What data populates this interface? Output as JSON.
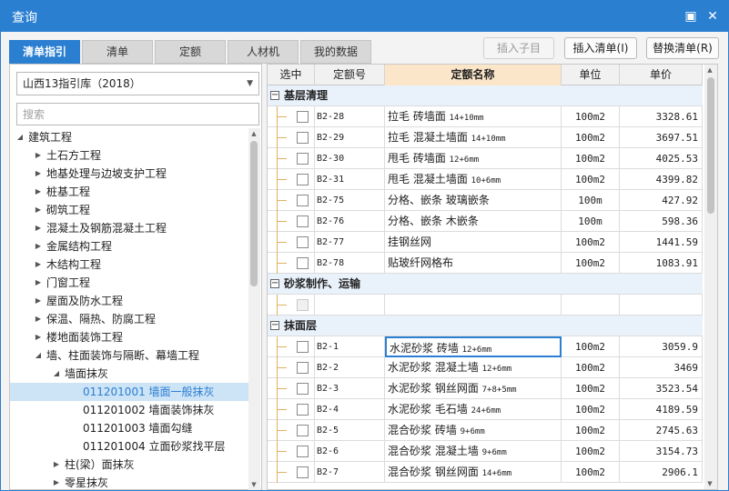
{
  "window": {
    "title": "查询",
    "restore_symbol": "▣",
    "close_symbol": "✕"
  },
  "tabs": [
    "清单指引",
    "清单",
    "定额",
    "人材机",
    "我的数据"
  ],
  "toolbar": {
    "insert_child": "插入子目",
    "insert_list": "插入清单(I)",
    "replace_list": "替换清单(R)"
  },
  "library": {
    "selected": "山西13指引库（2018）"
  },
  "search": {
    "placeholder": "搜索"
  },
  "tree": [
    {
      "label": "建筑工程",
      "level": 0,
      "state": "expanded"
    },
    {
      "label": "土石方工程",
      "level": 1,
      "state": "collapsed"
    },
    {
      "label": "地基处理与边坡支护工程",
      "level": 1,
      "state": "collapsed"
    },
    {
      "label": "桩基工程",
      "level": 1,
      "state": "collapsed"
    },
    {
      "label": "砌筑工程",
      "level": 1,
      "state": "collapsed"
    },
    {
      "label": "混凝土及钢筋混凝土工程",
      "level": 1,
      "state": "collapsed"
    },
    {
      "label": "金属结构工程",
      "level": 1,
      "state": "collapsed"
    },
    {
      "label": "木结构工程",
      "level": 1,
      "state": "collapsed"
    },
    {
      "label": "门窗工程",
      "level": 1,
      "state": "collapsed"
    },
    {
      "label": "屋面及防水工程",
      "level": 1,
      "state": "collapsed"
    },
    {
      "label": "保温、隔热、防腐工程",
      "level": 1,
      "state": "collapsed"
    },
    {
      "label": "楼地面装饰工程",
      "level": 1,
      "state": "collapsed"
    },
    {
      "label": "墙、柱面装饰与隔断、幕墙工程",
      "level": 1,
      "state": "expanded"
    },
    {
      "label": "墙面抹灰",
      "level": 2,
      "state": "expanded"
    },
    {
      "label": "011201001  墙面一般抹灰",
      "level": 3,
      "state": "leaf",
      "selected": true
    },
    {
      "label": "011201002  墙面装饰抹灰",
      "level": 3,
      "state": "leaf"
    },
    {
      "label": "011201003  墙面勾缝",
      "level": 3,
      "state": "leaf"
    },
    {
      "label": "011201004  立面砂浆找平层",
      "level": 3,
      "state": "leaf"
    },
    {
      "label": "柱(梁）面抹灰",
      "level": 2,
      "state": "collapsed"
    },
    {
      "label": "零星抹灰",
      "level": 2,
      "state": "collapsed"
    }
  ],
  "grid": {
    "headers": [
      "选中",
      "定额号",
      "定额名称",
      "单位",
      "单价"
    ],
    "groups": [
      {
        "name": "基层清理",
        "rows": [
          {
            "code": "B2-28",
            "name": "拉毛 砖墙面 ",
            "size": "14+10mm",
            "unit": "100m2",
            "price": "3328.61"
          },
          {
            "code": "B2-29",
            "name": "拉毛 混凝土墙面 ",
            "size": "14+10mm",
            "unit": "100m2",
            "price": "3697.51"
          },
          {
            "code": "B2-30",
            "name": "甩毛 砖墙面 ",
            "size": "12+6mm",
            "unit": "100m2",
            "price": "4025.53"
          },
          {
            "code": "B2-31",
            "name": "甩毛 混凝土墙面 ",
            "size": "10+6mm",
            "unit": "100m2",
            "price": "4399.82"
          },
          {
            "code": "B2-75",
            "name": "分格、嵌条 玻璃嵌条",
            "size": "",
            "unit": "100m",
            "price": "427.92"
          },
          {
            "code": "B2-76",
            "name": "分格、嵌条 木嵌条",
            "size": "",
            "unit": "100m",
            "price": "598.36"
          },
          {
            "code": "B2-77",
            "name": "挂钢丝网",
            "size": "",
            "unit": "100m2",
            "price": "1441.59"
          },
          {
            "code": "B2-78",
            "name": "贴玻纤网格布",
            "size": "",
            "unit": "100m2",
            "price": "1083.91"
          }
        ]
      },
      {
        "name": "砂浆制作、运输",
        "rows": [
          {
            "code": "",
            "name": "",
            "size": "",
            "unit": "",
            "price": "",
            "empty": true
          }
        ]
      },
      {
        "name": "抹面层",
        "rows": [
          {
            "code": "B2-1",
            "name": "水泥砂浆 砖墙 ",
            "size": "12+6mm",
            "unit": "100m2",
            "price": "3059.9",
            "focused": true
          },
          {
            "code": "B2-2",
            "name": "水泥砂浆 混凝土墙 ",
            "size": "12+6mm",
            "unit": "100m2",
            "price": "3469"
          },
          {
            "code": "B2-3",
            "name": "水泥砂浆 钢丝网面 ",
            "size": "7+8+5mm",
            "unit": "100m2",
            "price": "3523.54"
          },
          {
            "code": "B2-4",
            "name": "水泥砂浆 毛石墙 ",
            "size": "24+6mm",
            "unit": "100m2",
            "price": "4189.59"
          },
          {
            "code": "B2-5",
            "name": "混合砂浆 砖墙 ",
            "size": "9+6mm",
            "unit": "100m2",
            "price": "2745.63"
          },
          {
            "code": "B2-6",
            "name": "混合砂浆 混凝土墙 ",
            "size": "9+6mm",
            "unit": "100m2",
            "price": "3154.73"
          },
          {
            "code": "B2-7",
            "name": "混合砂浆 钢丝网面 ",
            "size": "14+6mm",
            "unit": "100m2",
            "price": "2906.1"
          }
        ]
      }
    ]
  },
  "colors": {
    "accent": "#2b7fd1",
    "header_highlight": "#fbe6c9",
    "selected_row": "#cde3f6"
  }
}
